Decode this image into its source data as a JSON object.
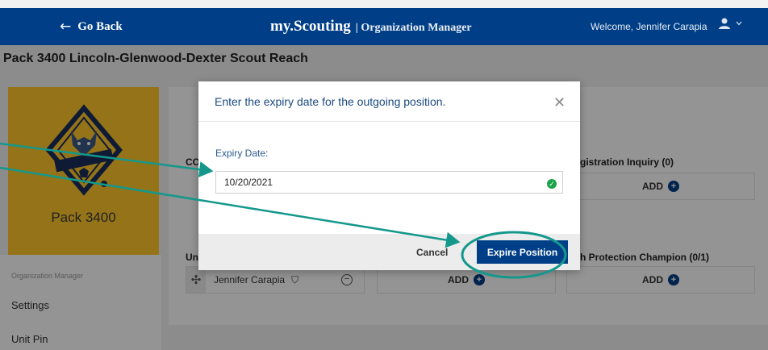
{
  "topbar": {
    "back_label": "Go Back",
    "brand_name": "my.Scouting",
    "brand_sub": "| Organization Manager",
    "welcome": "Welcome, Jennifer Carapia"
  },
  "unit": {
    "title": "Pack 3400 Lincoln-Glenwood-Dexter Scout Reach",
    "pack_name": "Pack 3400"
  },
  "sidebar": {
    "caption": "Organization Manager",
    "items": [
      {
        "label": "Settings"
      },
      {
        "label": "Unit Pin"
      }
    ]
  },
  "content": {
    "label_co": "CO",
    "label_inquiry": "gistration Inquiry (0)",
    "label_un": "Un",
    "label_ypc": "h Protection Champion (0/1)",
    "add_label": "ADD",
    "person_name": "Jennifer Carapia"
  },
  "modal": {
    "title": "Enter the expiry date for the outgoing position.",
    "field_label": "Expiry Date:",
    "date_value": "10/20/2021",
    "cancel_label": "Cancel",
    "expire_label": "Expire Position"
  },
  "colors": {
    "brand_blue": "#003f87",
    "annotation_teal": "#14988c",
    "logo_yellow": "#ffc72c",
    "valid_green": "#1aa34a"
  }
}
